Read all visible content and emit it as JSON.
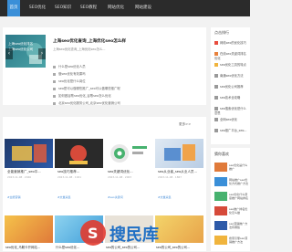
{
  "nav": {
    "items": [
      {
        "label": "首页"
      },
      {
        "label": "SEO优化"
      },
      {
        "label": "SEO知识"
      },
      {
        "label": "SEO教程"
      },
      {
        "label": "网站优化"
      },
      {
        "label": "网站建设"
      }
    ]
  },
  "banner": {
    "line1": "上海seo优化排名",
    "line2": "上海seo优化公司",
    "prev": "‹",
    "next": "›"
  },
  "headline": {
    "title": "上海seo优化查询_上海优化seo怎么样",
    "subtitle": "上海seo优化查询_上海优化seo怎么..."
  },
  "article_list": [
    "什么是seo优化人员",
    "做seo优化有效果吗",
    "seo优化是什么岗位",
    "seo是可以做哪些推广_seo可以做哪些推广呢",
    "如何做谷歌seo优化_谷歌seo怎么优化",
    "北京seo优化服务公司_北京seo优化营销公司"
  ],
  "more_label": "更多>>",
  "cards": [
    {
      "caption": "全能营销推广_seo平...",
      "meta": "2023-11-08 · 2046",
      "tag": "#全能营销"
    },
    {
      "caption": "seo技巧推荐...",
      "meta": "2023-11-08 · 1921",
      "tag": "#文章采集"
    },
    {
      "caption": "seo关键词优化...",
      "meta": "2023-11-08 · 2003",
      "tag": "#seo关键词"
    },
    {
      "caption": "seo从业者_seo从业人员...",
      "meta": "2023-11-08 · 1867",
      "tag": "#文章采集"
    }
  ],
  "bottom_captions": [
    "seo优化_马鞍卡开网站...",
    "什么是seo优化...",
    "seo的公司_seo的公司...",
    "seo的公司_seo的公司..."
  ],
  "sidebar": {
    "hot_title": "点击排行",
    "hot": [
      "网络seo的优化技巧",
      "在线seo关键词排名优化",
      "seo优化工具的特点",
      "南通seo优化方法",
      "seo优化公司推荐",
      "seo技术全攻略",
      "seo搜索优化是什么意思",
      "全网seo优化",
      "seo推广平台_seo..."
    ],
    "rec_title": "猜你喜欢",
    "rec": [
      "seo优化是什么推广",
      "网站推广seo优化方式推广方法",
      "seo优化什么意思推广网站排名",
      "seo推广排名优化怎么做",
      "seo营销推广方法有哪些",
      "搜索引擎seo营销推广方法"
    ]
  },
  "watermark_text": "搜民库",
  "colors": {
    "nav_bg": "#2b2b2b",
    "accent": "#3a8fd8",
    "hot_rank_1": "#e84c3d",
    "hot_rank_n": "#999999"
  }
}
